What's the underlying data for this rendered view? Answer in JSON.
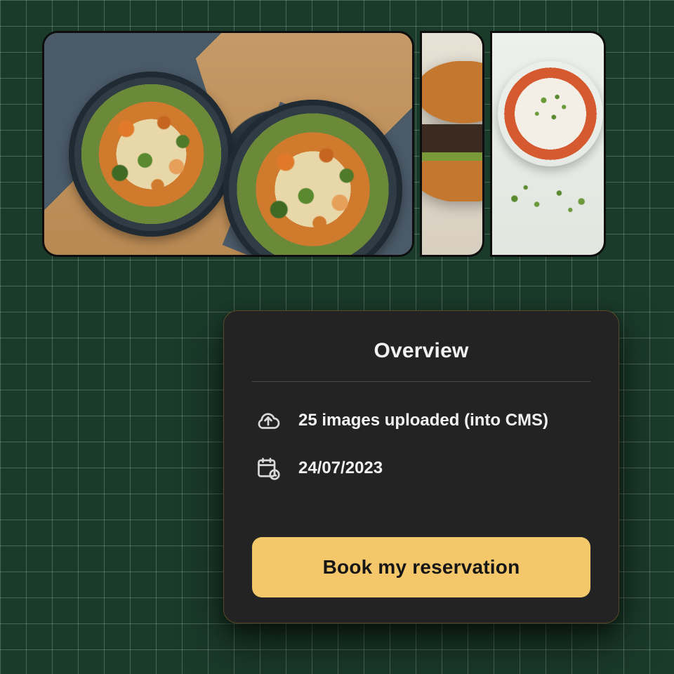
{
  "gallery": {
    "images": [
      {
        "name": "noodle-bowls-food-photo"
      },
      {
        "name": "burger-food-photo"
      },
      {
        "name": "dip-sauce-food-photo"
      }
    ]
  },
  "card": {
    "title": "Overview",
    "upload_status": "25 images uploaded (into CMS)",
    "date": "24/07/2023",
    "cta_label": "Book my reservation"
  },
  "colors": {
    "card_bg": "#232323",
    "accent": "#f4c86a",
    "grid_bg": "#1a3a2a"
  }
}
